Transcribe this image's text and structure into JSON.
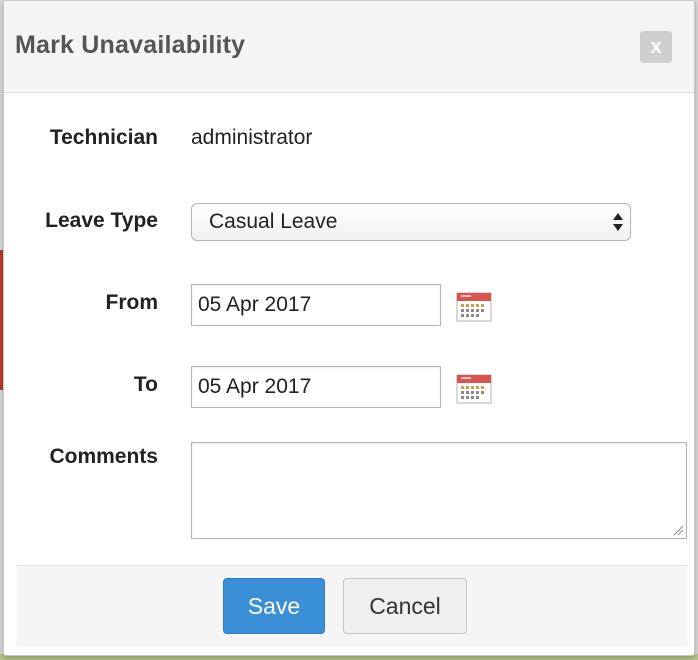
{
  "dialog": {
    "title": "Mark Unavailability",
    "close_label": "x"
  },
  "form": {
    "technician": {
      "label": "Technician",
      "value": "administrator"
    },
    "leave_type": {
      "label": "Leave Type",
      "selected": "Casual Leave"
    },
    "from": {
      "label": "From",
      "value": "05 Apr 2017"
    },
    "to": {
      "label": "To",
      "value": "05 Apr 2017"
    },
    "comments": {
      "label": "Comments",
      "value": ""
    }
  },
  "footer": {
    "save_label": "Save",
    "cancel_label": "Cancel"
  },
  "colors": {
    "primary": "#3a8fd6",
    "calendar_red": "#d9534f"
  },
  "icons": {
    "close": "close-icon",
    "calendar": "calendar-icon",
    "select_arrows": "select-arrows-icon",
    "resize": "resize-handle-icon"
  }
}
